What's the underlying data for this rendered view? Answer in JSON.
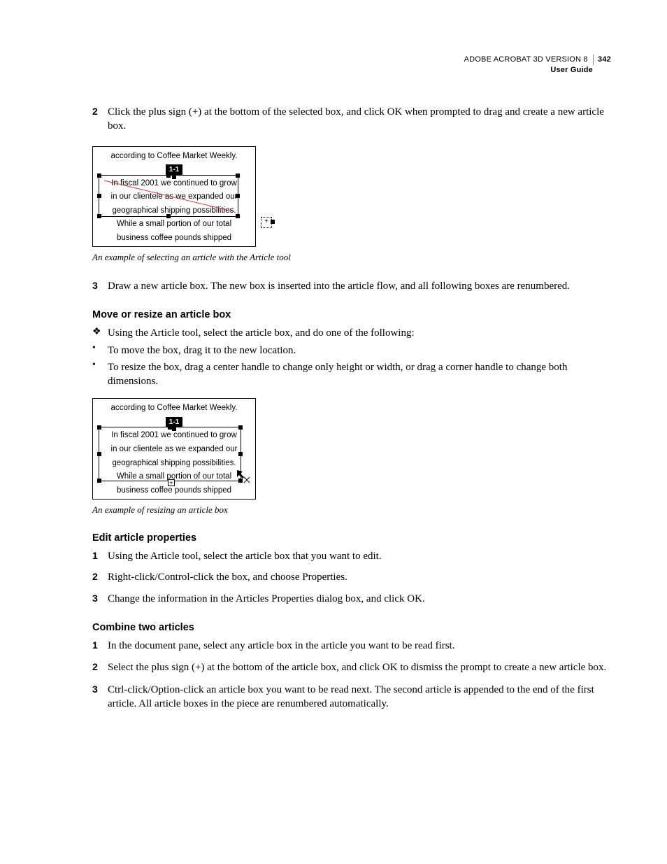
{
  "header": {
    "product": "ADOBE ACROBAT 3D VERSION 8",
    "page_number": "342",
    "doc_title": "User Guide"
  },
  "step2": {
    "num": "2",
    "text": "Click the plus sign (+) at the bottom of the selected box, and click OK when prompted to drag and create a new article box."
  },
  "fig1": {
    "l1": "according to Coffee Market Weekly.",
    "tag": "1-1",
    "l2": "In fiscal 2001 we continued to grow",
    "l3": "in our clientele as we expanded our",
    "l4": "geographical shipping possibilities.",
    "l5": "While a small portion of our total",
    "l6": "business coffee pounds shipped",
    "caption": "An example of selecting an article with the Article tool"
  },
  "step3": {
    "num": "3",
    "text": "Draw a new article box. The new box is inserted into the article flow, and all following boxes are renumbered."
  },
  "sec_move": {
    "title": "Move or resize an article box",
    "lead": "Using the Article tool, select the article box, and do one of the following:",
    "b1": "To move the box, drag it to the new location.",
    "b2": "To resize the box, drag a center handle to change only height or width, or drag a corner handle to change both dimensions."
  },
  "fig2": {
    "l1": "according to Coffee Market Weekly.",
    "tag": "1-1",
    "l2": "In fiscal 2001 we continued to grow",
    "l3": "in our clientele as we expanded our",
    "l4": "geographical shipping possibilities.",
    "l5": "While a small portion of our total",
    "l6": "business coffee pounds shipped",
    "caption": "An example of resizing an article box"
  },
  "sec_edit": {
    "title": "Edit article properties",
    "s1n": "1",
    "s1": "Using the Article tool, select the article box that you want to edit.",
    "s2n": "2",
    "s2": "Right-click/Control-click the box, and choose Properties.",
    "s3n": "3",
    "s3": "Change the information in the Articles Properties dialog box, and click OK."
  },
  "sec_combine": {
    "title": "Combine two articles",
    "s1n": "1",
    "s1": "In the document pane, select any article box in the article you want to be read first.",
    "s2n": "2",
    "s2": "Select the plus sign (+) at the bottom of the article box, and click OK to dismiss the prompt to create a new article box.",
    "s3n": "3",
    "s3": "Ctrl-click/Option-click an article box you want to be read next. The second article is appended to the end of the first article. All article boxes in the piece are renumbered automatically."
  }
}
